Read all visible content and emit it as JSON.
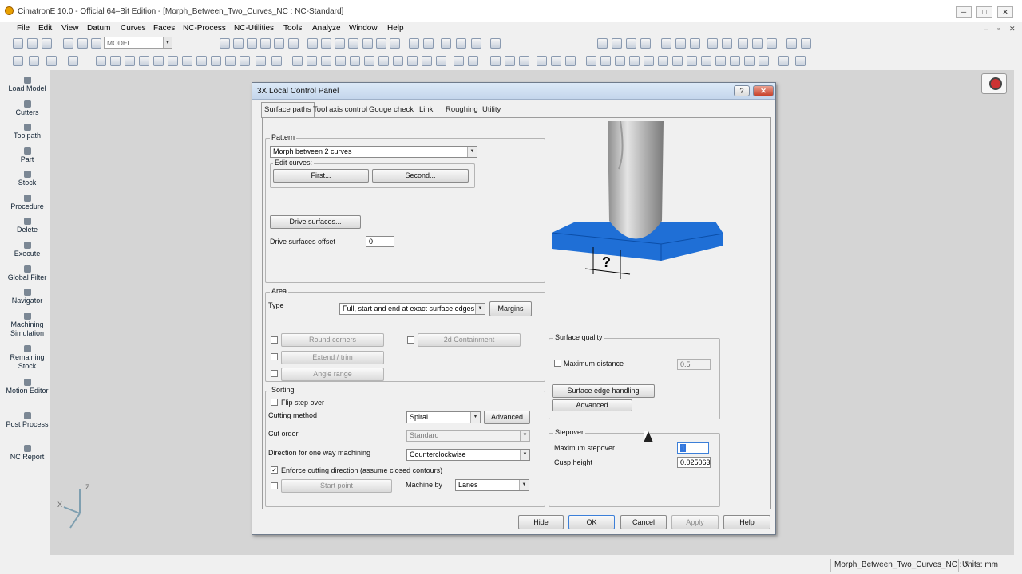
{
  "app": {
    "title": "CimatronE 10.0 - Official 64–Bit Edition - [Morph_Between_Two_Curves_NC : NC-Standard]",
    "win_min": "─",
    "win_max": "□",
    "win_close": "✕",
    "mdi_min": "–",
    "mdi_restore": "▫",
    "mdi_close": "✕"
  },
  "menu": [
    "File",
    "Edit",
    "View",
    "Datum",
    "Curves",
    "Faces",
    "NC-Process",
    "NC-Utilities",
    "Tools",
    "Analyze",
    "Window",
    "Help"
  ],
  "toolbar": {
    "model_combo": "MODEL"
  },
  "sidebar": [
    "Load Model",
    "Cutters",
    "Toolpath",
    "Part",
    "Stock",
    "Procedure",
    "Delete",
    "Execute",
    "Global Filter",
    "Navigator",
    "Machining Simulation",
    "Remaining Stock",
    "Motion Editor",
    "Post Process",
    "NC Report"
  ],
  "axes": {
    "z": "Z",
    "x": "X"
  },
  "dialog": {
    "title": "3X Local Control Panel",
    "help": "?",
    "close": "✕",
    "tabs": [
      "Surface paths",
      "Tool axis control",
      "Gouge check",
      "Link",
      "Roughing",
      "Utility"
    ],
    "pattern": {
      "label": "Pattern",
      "value": "Morph between 2 curves",
      "edit_curves": "Edit curves:",
      "first": "First...",
      "second": "Second...",
      "drive_surfaces": "Drive surfaces...",
      "drive_offset_label": "Drive surfaces offset",
      "drive_offset": "0"
    },
    "area": {
      "label": "Area",
      "type_label": "Type",
      "type_value": "Full, start and end at exact surface edges",
      "margins": "Margins",
      "round_corners": "Round corners",
      "containment": "2d Containment",
      "extend_trim": "Extend / trim",
      "angle_range": "Angle range"
    },
    "sorting": {
      "label": "Sorting",
      "flip": "Flip step over",
      "cutting_method_label": "Cutting method",
      "cutting_method": "Spiral",
      "advanced": "Advanced",
      "cut_order_label": "Cut order",
      "cut_order": "Standard",
      "direction_label": "Direction for one way machining",
      "direction": "Counterclockwise",
      "enforce": "Enforce cutting direction (assume closed contours)",
      "start_point": "Start point",
      "machine_by_label": "Machine by",
      "machine_by": "Lanes"
    },
    "surface_quality": {
      "label": "Surface quality",
      "max_distance_label": "Maximum distance",
      "max_distance": "0.5",
      "edge_handling": "Surface edge handling",
      "advanced": "Advanced"
    },
    "stepover": {
      "label": "Stepover",
      "max_stepover_label": "Maximum stepover",
      "max_stepover": "1",
      "cusp_label": "Cusp height",
      "cusp": "0.025063"
    },
    "illustration_text": "?",
    "footer": {
      "hide": "Hide",
      "ok": "OK",
      "cancel": "Cancel",
      "apply": "Apply",
      "help": "Help"
    }
  },
  "status": {
    "doc": "Morph_Between_Two_Curves_NC : N",
    "units": "Units: mm"
  }
}
